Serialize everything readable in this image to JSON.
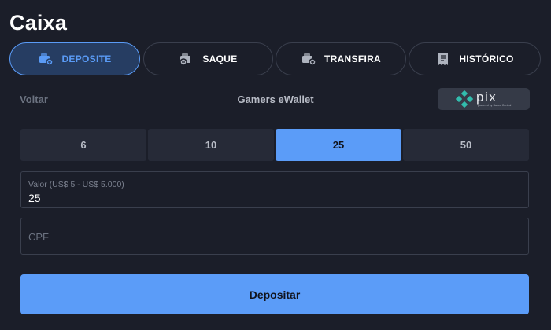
{
  "title": "Caixa",
  "tabs": [
    {
      "label": "DEPOSITE",
      "icon": "wallet-icon",
      "active": true
    },
    {
      "label": "SAQUE",
      "icon": "wallet-withdraw-icon",
      "active": false
    },
    {
      "label": "TRANSFIRA",
      "icon": "transfer-icon",
      "active": false
    },
    {
      "label": "HISTÓRICO",
      "icon": "receipt-icon",
      "active": false
    }
  ],
  "back_label": "Voltar",
  "provider_name": "Gamers eWallet",
  "pix": {
    "logo_text": "pix",
    "tagline": "powered by Banco Central"
  },
  "amounts": [
    "6",
    "10",
    "25",
    "50"
  ],
  "selected_amount": "25",
  "value_field": {
    "label": "Valor (US$ 5 - US$ 5.000)",
    "value": "25"
  },
  "cpf_field": {
    "placeholder": "CPF",
    "value": ""
  },
  "submit_label": "Depositar",
  "colors": {
    "background": "#1b1e29",
    "accent": "#5b9cf8",
    "pix_teal": "#32bcad"
  }
}
